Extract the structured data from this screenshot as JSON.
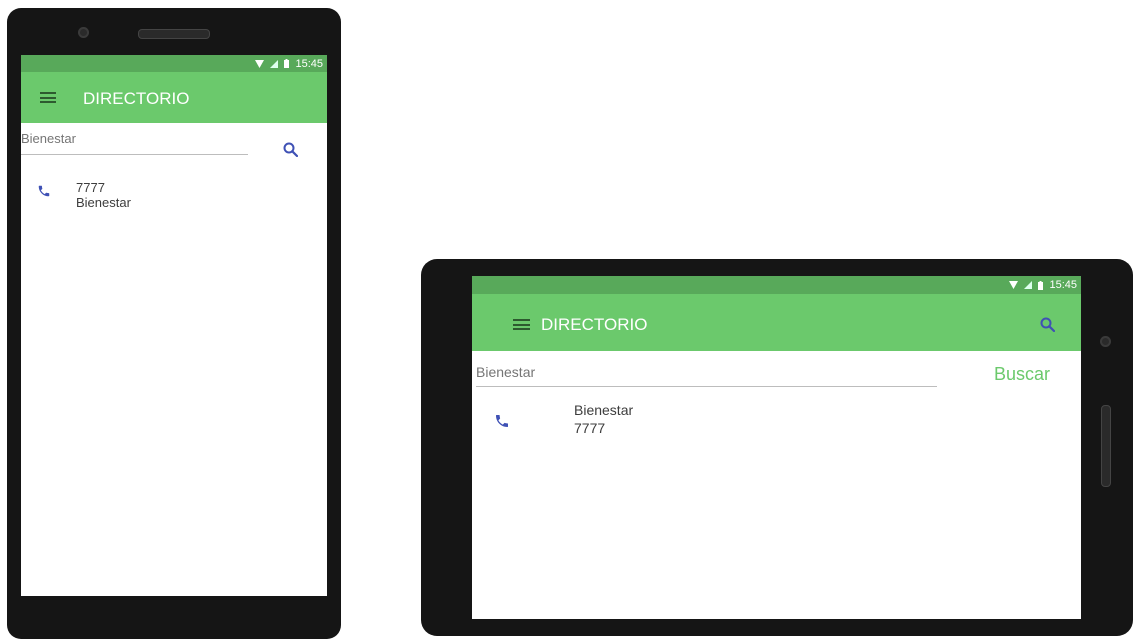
{
  "portrait": {
    "status": {
      "time": "15:45",
      "wifi_icon": "wifi-icon",
      "signal_icon": "signal-icon",
      "battery_icon": "battery-icon"
    },
    "appbar": {
      "menu_icon": "menu-icon",
      "title": "DIRECTORIO"
    },
    "search": {
      "value": "Bienestar",
      "placeholder": "",
      "search_icon": "search-icon"
    },
    "results": [
      {
        "icon": "phone-icon",
        "line1": "7777",
        "line2": "Bienestar"
      }
    ]
  },
  "landscape": {
    "status": {
      "time": "15:45",
      "wifi_icon": "wifi-icon",
      "signal_icon": "signal-icon",
      "battery_icon": "battery-icon"
    },
    "appbar": {
      "menu_icon": "menu-icon",
      "title": "DIRECTORIO",
      "search_icon": "search-icon"
    },
    "search": {
      "value": "Bienestar",
      "placeholder": "",
      "button_label": "Buscar"
    },
    "results": [
      {
        "icon": "phone-icon",
        "line1": "Bienestar",
        "line2": "7777"
      }
    ]
  },
  "colors": {
    "statusbar": "#58a95a",
    "appbar": "#6bc96c",
    "accent_text": "#6bc96c",
    "phone_icon": "#3f51b5",
    "device": "#151515"
  }
}
